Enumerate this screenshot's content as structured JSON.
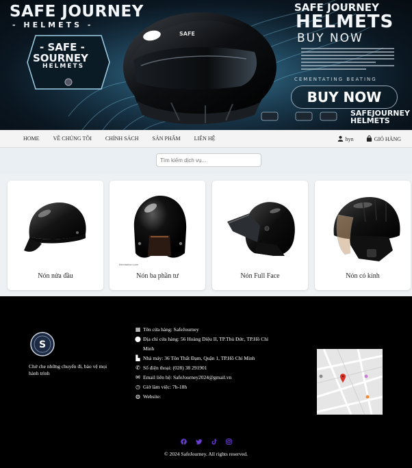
{
  "banner": {
    "brand_top": "SAFE JOURNEY",
    "brand_top_sub": "- HELMETS -",
    "badge_line1": "- SAFE -",
    "badge_line2": "SOURNEY",
    "badge_line3": "HELMETS",
    "right_line1": "SAFE JOURNEY",
    "right_line2": "HELMETS",
    "right_line3": "BUY NOW",
    "right_cement": "CEMENTATING BEATING",
    "buy_now_button": "BUY NOW",
    "right_brand": "SAFEJOURNEY\nHELMETS",
    "helmet_label": "SAFE"
  },
  "nav": {
    "items": [
      {
        "label": "HOME"
      },
      {
        "label": "VỀ CHÚNG TÔI"
      },
      {
        "label": "CHÍNH SÁCH"
      },
      {
        "label": "SẢN PHẨM"
      },
      {
        "label": "LIÊN HỆ"
      }
    ],
    "user_label": "hyn",
    "cart_label": "GIỎ HÀNG",
    "user_icon": "user-icon",
    "cart_icon": "shopping-bag-icon"
  },
  "search": {
    "placeholder": "Tìm kiếm dịch vụ..."
  },
  "products": [
    {
      "name": "Nón nửa đầu"
    },
    {
      "name": "Nón ba phần tư"
    },
    {
      "name": "Nón Full Face"
    },
    {
      "name": "Nón có kính"
    }
  ],
  "footer": {
    "logo_text": "S",
    "tagline": "Chở che những chuyến đi, bảo vệ mọi hành trình",
    "info": [
      {
        "icon": "store-icon",
        "text": "Tên cửa hàng: SafeJourney"
      },
      {
        "icon": "map-marker-icon",
        "text": "Địa chỉ cửa hàng: 56 Hoàng Diệu II, TP.Thủ Đức, TP.Hồ Chí Minh"
      },
      {
        "icon": "industry-icon",
        "text": "Nhà máy: 36 Tôn Thất Đạm, Quận 1, TP.Hồ Chí Minh"
      },
      {
        "icon": "phone-icon",
        "text": "Số điện thoại: (028) 38 291901"
      },
      {
        "icon": "envelope-icon",
        "text": "Email liên hệ: SafeJourney2024@gmail.vn"
      },
      {
        "icon": "clock-icon",
        "text": "Giờ làm việc: 7h-18h"
      },
      {
        "icon": "globe-icon",
        "text": "Website:"
      }
    ],
    "socials": [
      "facebook-icon",
      "twitter-icon",
      "tiktok-icon",
      "instagram-icon"
    ],
    "copyright": "© 2024 SafeJourney. All rights reserved."
  },
  "colors": {
    "footer_bg": "#000000",
    "social_accent": "#6a3bd6",
    "nav_bg": "#f4f4f4",
    "search_band_bg": "#e9eff3"
  }
}
